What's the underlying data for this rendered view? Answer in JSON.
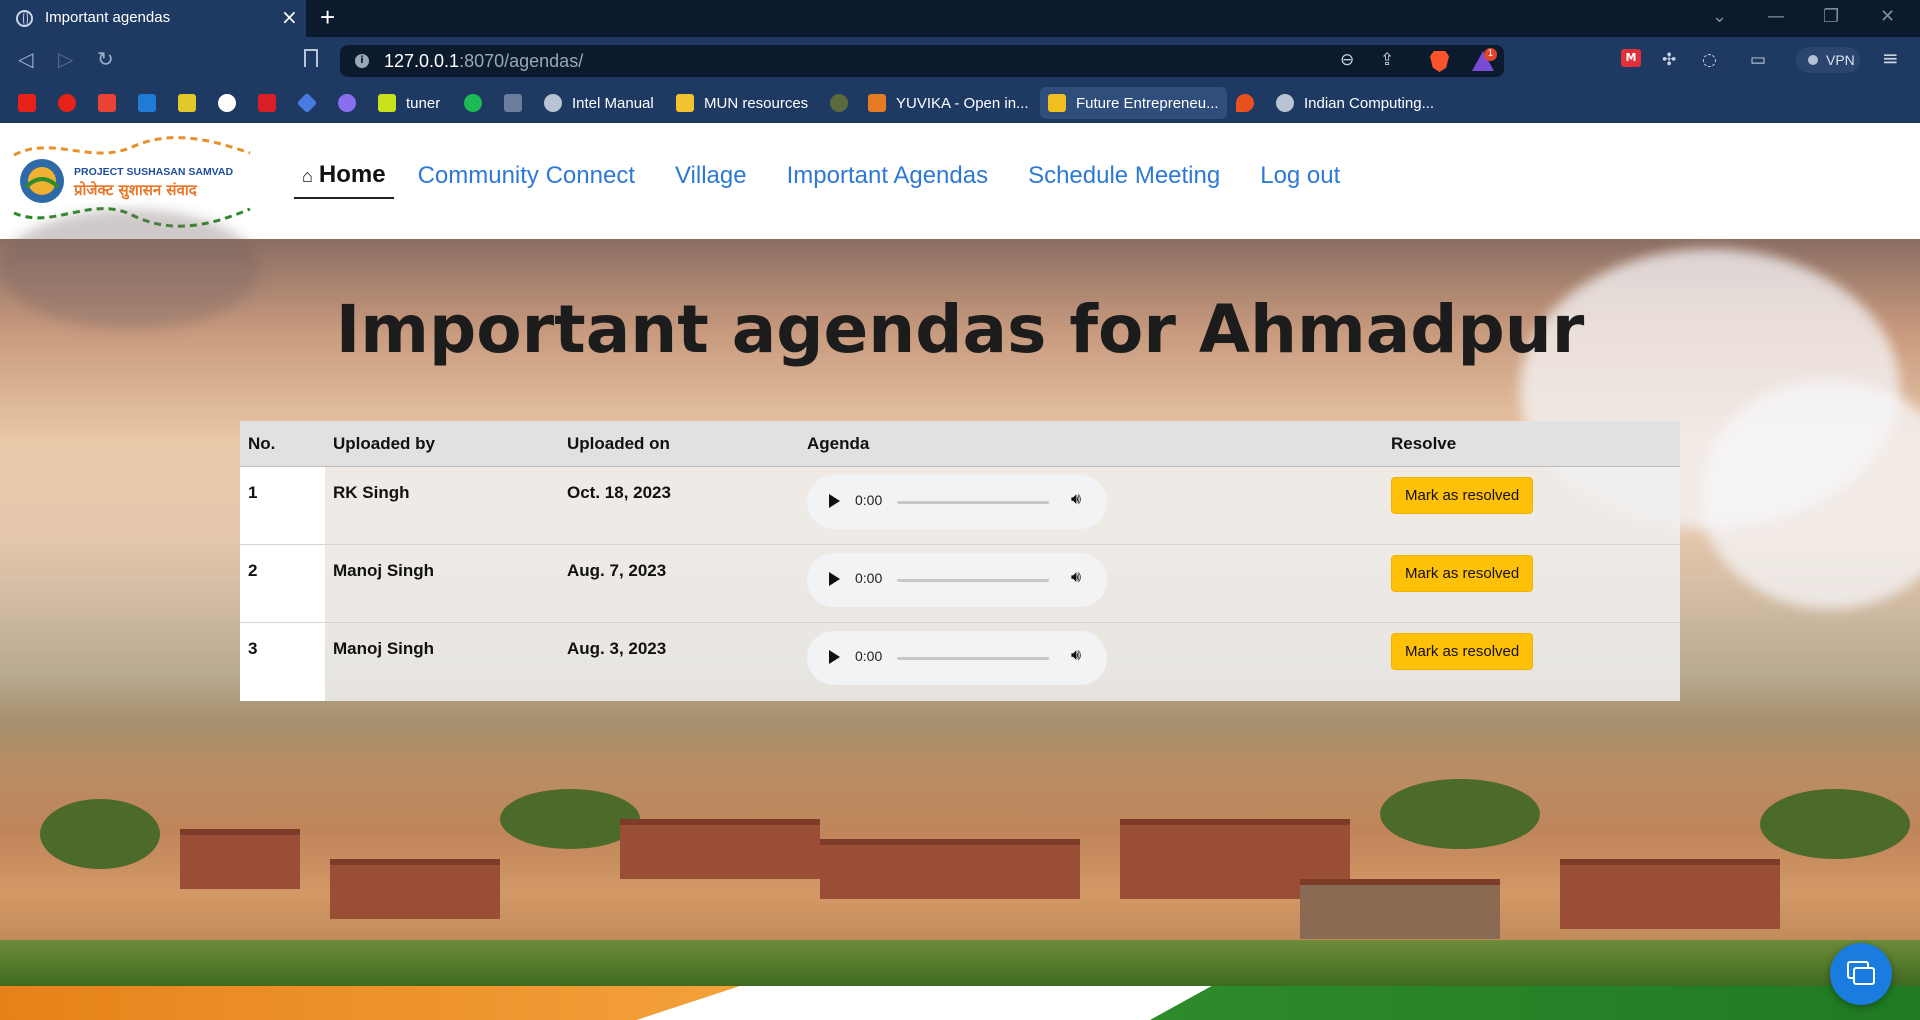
{
  "browser": {
    "tab_title": "Important agendas",
    "tab_close": "×",
    "new_tab": "+",
    "url_host": "127.0.0.1",
    "url_rest": ":8070/agendas/",
    "rewards_count": "1",
    "vpn_label": "VPN",
    "window_controls": [
      "⌄",
      "—",
      "❐",
      "✕"
    ],
    "bookmarks": [
      {
        "label": "tuner",
        "icon": "lemon-icon",
        "color": "#c8e21c"
      },
      {
        "label": "Intel Manual",
        "icon": "globe-icon",
        "color": "#b8c4d4"
      },
      {
        "label": "MUN resources",
        "icon": "folder-icon",
        "color": "#f2c230"
      },
      {
        "label": "YUVIKA - Open in...",
        "icon": "isro-icon",
        "color": "#e47a22"
      },
      {
        "label": "Future Entrepreneu...",
        "icon": "arrow-logo-icon",
        "color": "#f0c020"
      },
      {
        "label": "Indian Computing...",
        "icon": "globe-icon",
        "color": "#b8c4d4"
      }
    ]
  },
  "site": {
    "logo_line1": "PROJECT SUSHASAN SAMVAD",
    "logo_line2": "प्रोजेक्ट सुशासन संवाद",
    "nav": {
      "home": "Home",
      "links": [
        "Community Connect",
        "Village",
        "Important Agendas",
        "Schedule Meeting",
        "Log out"
      ]
    },
    "heading": "Important agendas for Ahmadpur",
    "table": {
      "headers": [
        "No.",
        "Uploaded by",
        "Uploaded on",
        "Agenda",
        "Resolve"
      ],
      "rows": [
        {
          "no": "1",
          "by": "RK Singh",
          "on": "Oct. 18, 2023",
          "time": "0:00",
          "action": "Mark as resolved"
        },
        {
          "no": "2",
          "by": "Manoj Singh",
          "on": "Aug. 7, 2023",
          "time": "0:00",
          "action": "Mark as resolved"
        },
        {
          "no": "3",
          "by": "Manoj Singh",
          "on": "Aug. 3, 2023",
          "time": "0:00",
          "action": "Mark as resolved"
        }
      ]
    },
    "colors": {
      "accent_link": "#2e79d6",
      "resolve_button": "#ffc107",
      "chat_fab": "#1a7cde"
    }
  }
}
